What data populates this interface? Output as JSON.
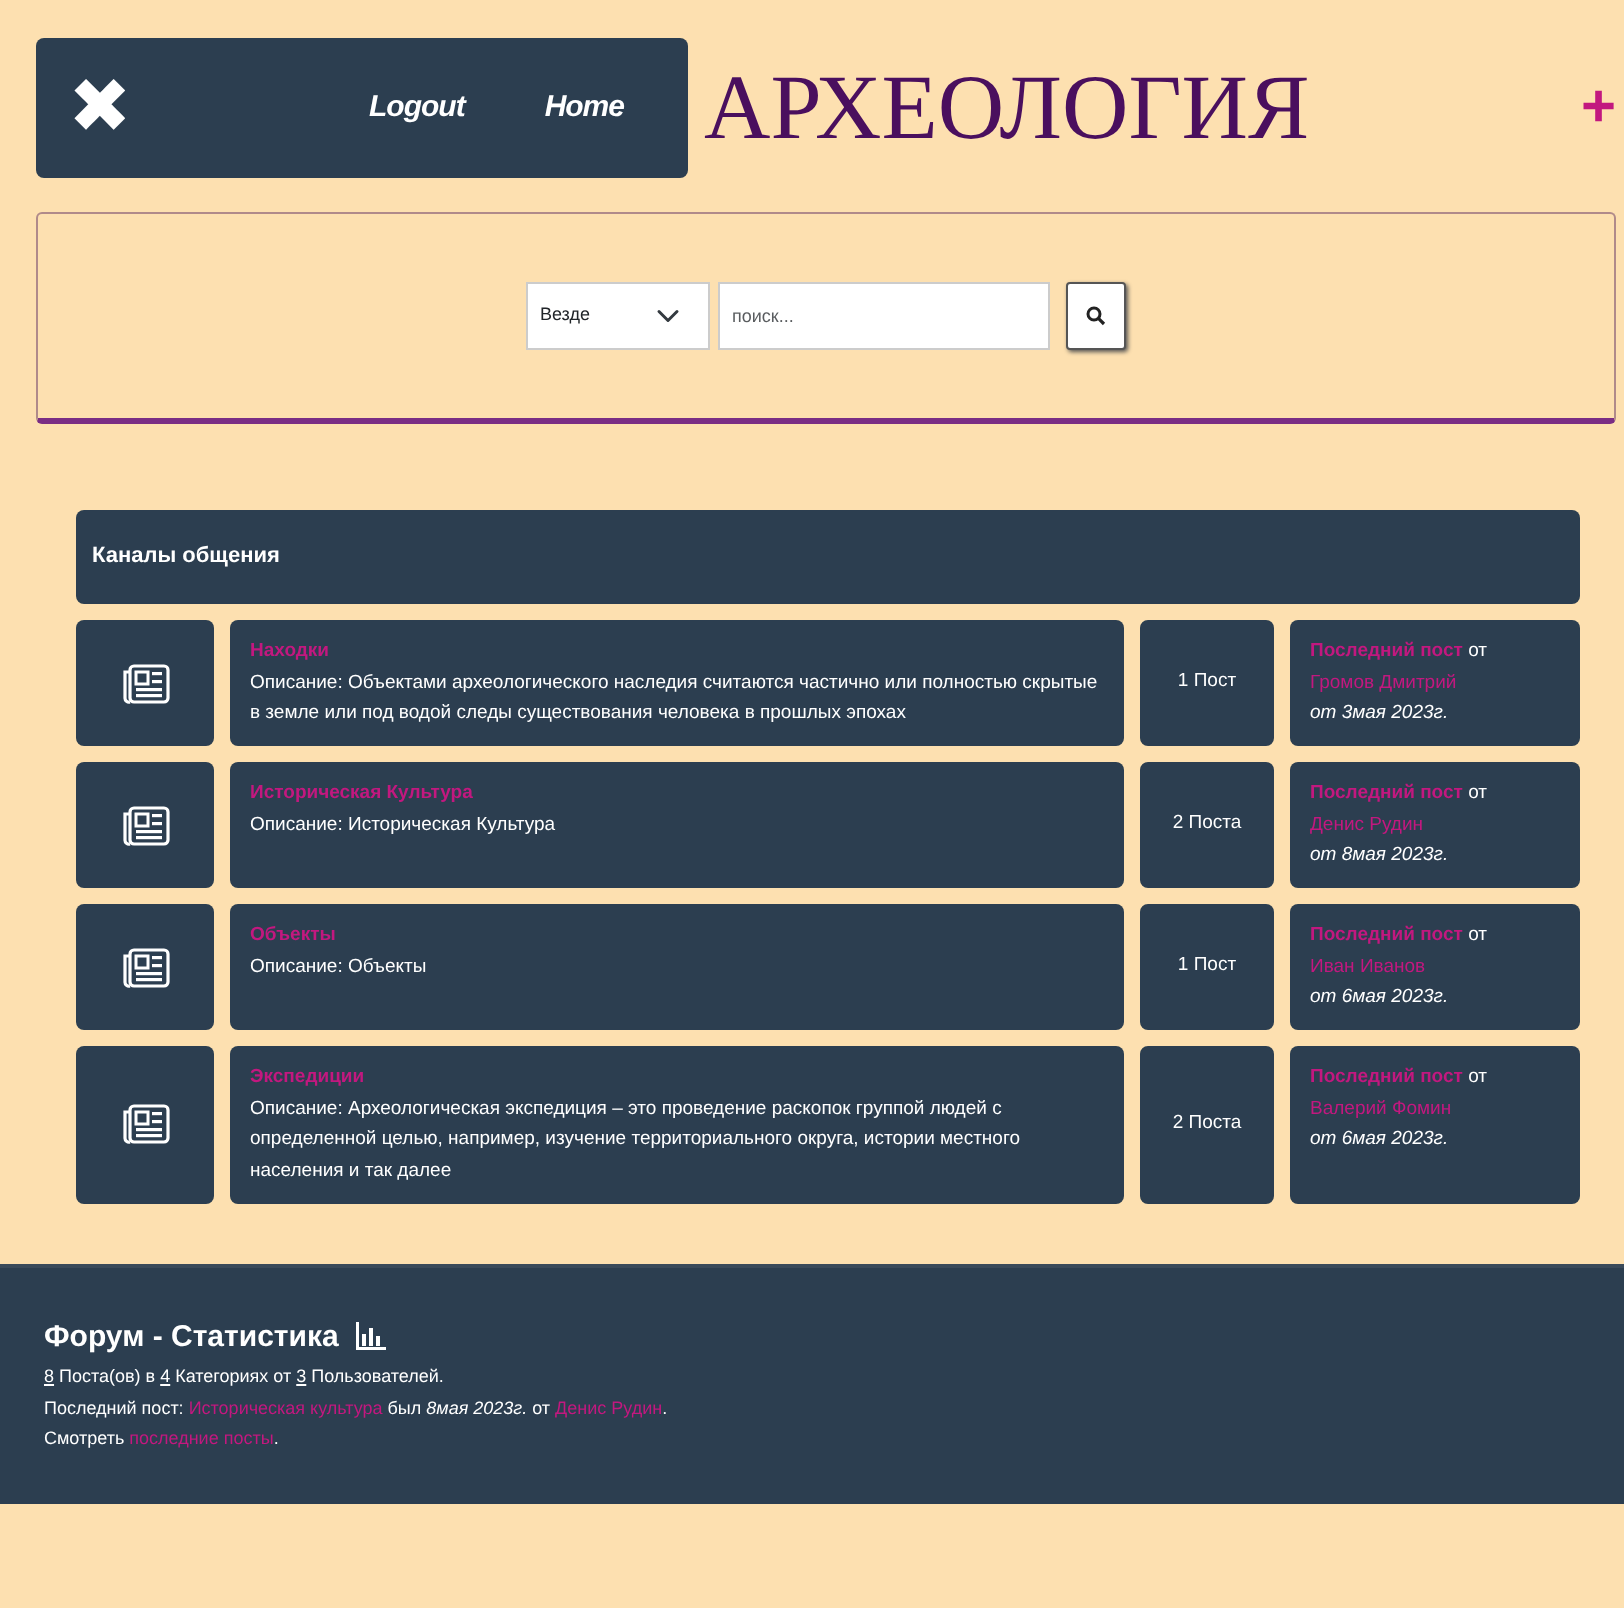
{
  "header": {
    "close_icon": "✖",
    "nav": [
      {
        "label": "Logout"
      },
      {
        "label": "Home"
      }
    ],
    "title": "АРХЕОЛОГИЯ",
    "plus": "+"
  },
  "search": {
    "select_value": "Везде",
    "placeholder": "поиск..."
  },
  "channels": {
    "title": "Каналы общения",
    "rows": [
      {
        "name": "Находки",
        "description": "Описание: Объектами археологического наследия считаются частично или полностью скрытые в земле или под водой следы существования человека в прошлых эпохах",
        "count": "1 Пост",
        "last_post": "Последний пост",
        "from": "от",
        "author": "Громов Дмитрий",
        "date": "от 3мая 2023г."
      },
      {
        "name": "Историческая Культура",
        "description": "Описание: Историческая Культура",
        "count": "2 Поста",
        "last_post": "Последний пост",
        "from": "от",
        "author": "Денис Рудин",
        "date": "от 8мая 2023г."
      },
      {
        "name": "Объекты",
        "description": "Описание: Объекты",
        "count": "1 Пост",
        "last_post": "Последний пост",
        "from": "от",
        "author": "Иван Иванов",
        "date": "от 6мая 2023г."
      },
      {
        "name": "Экспедиции",
        "description": "Описание: Археологическая экспедиция – это проведение раскопок группой людей с определенной целью, например, изучение территориального округа, истории местного населения и так далее",
        "count": "2 Поста",
        "last_post": "Последний пост",
        "from": "от",
        "author": "Валерий Фомин",
        "date": "от 6мая 2023г."
      }
    ]
  },
  "stats": {
    "title": "Форум - Статистика",
    "line1": [
      {
        "text": "8",
        "kind": "link"
      },
      {
        "text": " Поста(ов) в ",
        "kind": "text"
      },
      {
        "text": "4",
        "kind": "link"
      },
      {
        "text": " Категориях от ",
        "kind": "text"
      },
      {
        "text": "3",
        "kind": "link"
      },
      {
        "text": " Пользователей.",
        "kind": "text"
      }
    ],
    "line2": [
      {
        "text": "Последний пост: ",
        "kind": "text"
      },
      {
        "text": "Историческая культура",
        "kind": "accent"
      },
      {
        "text": " был ",
        "kind": "text"
      },
      {
        "text": "8мая 2023г.",
        "kind": "italic"
      },
      {
        "text": " от ",
        "kind": "text"
      },
      {
        "text": "Денис Рудин",
        "kind": "accent"
      },
      {
        "text": ".",
        "kind": "text"
      }
    ],
    "line3": [
      {
        "text": "Смотреть ",
        "kind": "text"
      },
      {
        "text": "последние посты",
        "kind": "accent"
      },
      {
        "text": ".",
        "kind": "text"
      }
    ]
  }
}
